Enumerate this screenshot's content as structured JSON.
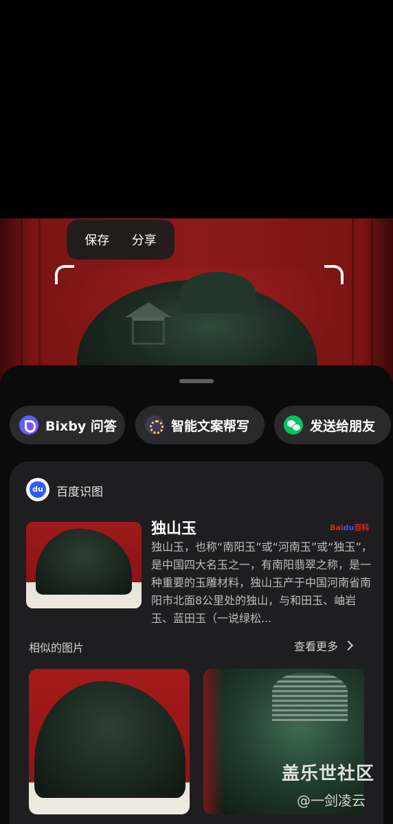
{
  "popup": {
    "save_label": "保存",
    "share_label": "分享"
  },
  "chips": [
    {
      "label": "Bixby 问答",
      "icon": "bixby-icon"
    },
    {
      "label": "智能文案帮写",
      "icon": "smart-write-icon"
    },
    {
      "label": "发送给朋友",
      "icon": "wechat-icon"
    }
  ],
  "card": {
    "provider": "百度识图",
    "badge": {
      "part1": "Bai",
      "part2": "du",
      "part3": "百科"
    },
    "result_title": "独山玉",
    "result_desc": "独山玉，也称“南阳玉”或“河南玉”或“独玉”，是中国四大名玉之一，有南阳翡翠之称，是一种重要的玉雕材料，独山玉产于中国河南省南阳市北面8公里处的独山，与和田玉、岫岩玉、蓝田玉（一说绿松...",
    "similar_title": "相似的图片",
    "see_more": "查看更多"
  },
  "watermark": {
    "line1": "盖乐世社区",
    "line2": "@一剑凌云"
  },
  "colors": {
    "sheet_bg": "#0b0b0b",
    "card_bg": "#1e1e20",
    "chip_bg": "#2a2a2c",
    "wechat_green": "#07c160"
  }
}
